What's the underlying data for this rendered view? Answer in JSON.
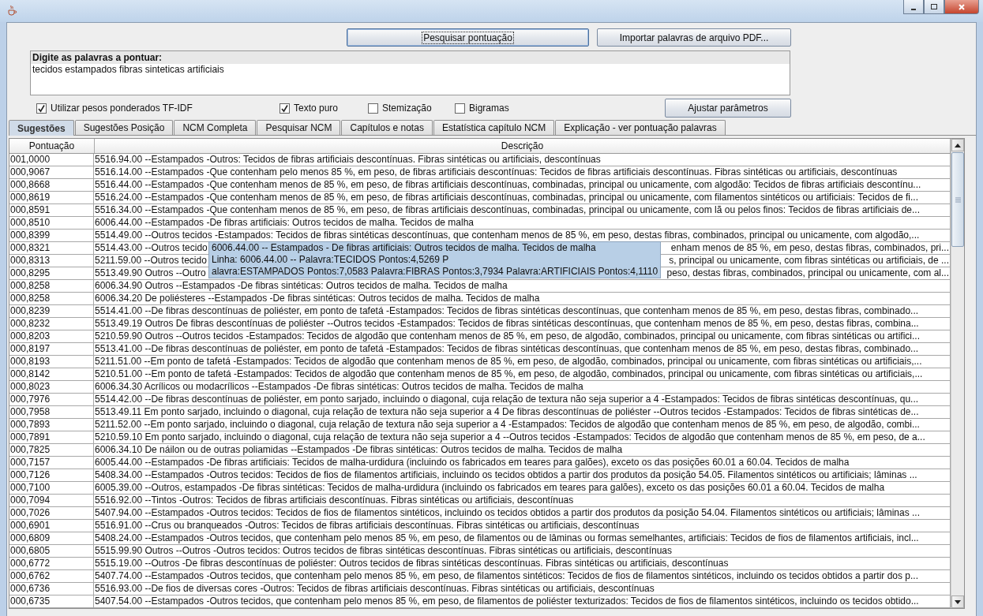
{
  "actions": [
    {
      "label": "Pesquisar pontuação",
      "focused": true
    },
    {
      "label": "Importar palavras de arquivo PDF...",
      "focused": false
    }
  ],
  "query": {
    "label": "Digite as palavras a pontuar:",
    "value": "tecidos estampados fibras sinteticas artificiais"
  },
  "options": [
    {
      "label": "Utilizar pesos ponderados TF-IDF",
      "checked": true
    },
    {
      "label": "Texto puro",
      "checked": true
    },
    {
      "label": "Stemização",
      "checked": false
    },
    {
      "label": "Bigramas",
      "checked": false
    }
  ],
  "adjust_button": "Ajustar parâmetros",
  "tabs": [
    {
      "label": "Sugestões",
      "selected": true
    },
    {
      "label": "Sugestões Posição",
      "selected": false
    },
    {
      "label": "NCM Completa",
      "selected": false
    },
    {
      "label": "Pesquisar NCM",
      "selected": false
    },
    {
      "label": "Capítulos e notas",
      "selected": false
    },
    {
      "label": "Estatística capítulo NCM",
      "selected": false
    },
    {
      "label": "Explicação - ver pontuação palavras",
      "selected": false
    }
  ],
  "table": {
    "columns": [
      "Pontuação",
      "Descrição"
    ],
    "rows": [
      {
        "score": "001,0000",
        "description": "5516.94.00 --Estampados -Outros: Tecidos de fibras artificiais descontínuas. Fibras sintéticas ou artificiais, descontínuas"
      },
      {
        "score": "000,9067",
        "description": "5516.14.00 --Estampados -Que contenham pelo menos 85 %, em peso, de fibras artificiais descontínuas: Tecidos de fibras artificiais descontínuas. Fibras sintéticas ou artificiais, descontínuas"
      },
      {
        "score": "000,8668",
        "description": "5516.44.00 --Estampados -Que contenham menos de 85 %, em peso, de fibras artificiais descontínuas, combinadas, principal ou unicamente, com algodão: Tecidos de fibras artificiais descontínu..."
      },
      {
        "score": "000,8619",
        "description": "5516.24.00 --Estampados -Que contenham menos de 85 %, em peso, de fibras artificiais descontínuas, combinadas, principal ou unicamente, com filamentos sintéticos ou artificiais: Tecidos de fi..."
      },
      {
        "score": "000,8591",
        "description": "5516.34.00 --Estampados -Que contenham menos de 85 %, em peso, de fibras artificiais descontínuas, combinadas, principal ou unicamente, com lã ou pelos finos: Tecidos de fibras artificiais de..."
      },
      {
        "score": "000,8510",
        "description": "6006.44.00 --Estampados -De fibras artificiais: Outros tecidos de malha. Tecidos de malha"
      },
      {
        "score": "000,8399",
        "description": "5514.49.00 --Outros tecidos -Estampados: Tecidos de fibras sintéticas descontínuas, que contenham menos de 85 %, em peso, destas fibras, combinados, principal ou unicamente, com algodão,..."
      },
      {
        "score": "000,8321",
        "description": "5514.43.00 --Outros tecido",
        "description_tail": "enham menos de 85 %, em peso, destas fibras, combinados, pri..."
      },
      {
        "score": "000,8313",
        "description": "5211.59.00 --Outros tecido",
        "description_tail": "s, principal ou unicamente, com fibras sintéticas ou artificiais, de ..."
      },
      {
        "score": "000,8295",
        "description": "5513.49.90 Outros --Outro",
        "description_tail": "peso, destas fibras, combinados, principal ou unicamente, com al..."
      },
      {
        "score": "000,8258",
        "description": "6006.34.90 Outros --Estampados -De fibras sintéticas: Outros tecidos de malha. Tecidos de malha"
      },
      {
        "score": "000,8258",
        "description": "6006.34.20 De poliésteres --Estampados -De fibras sintéticas: Outros tecidos de malha. Tecidos de malha"
      },
      {
        "score": "000,8239",
        "description": "5514.41.00 --De fibras descontínuas de poliéster, em ponto de tafetá -Estampados: Tecidos de fibras sintéticas descontínuas, que contenham menos de 85 %, em peso, destas fibras, combinado..."
      },
      {
        "score": "000,8232",
        "description": "5513.49.19 Outros De fibras descontínuas de poliéster --Outros tecidos -Estampados: Tecidos de fibras sintéticas descontínuas, que contenham menos de 85 %, em peso, destas fibras, combina..."
      },
      {
        "score": "000,8203",
        "description": "5210.59.90 Outros --Outros tecidos -Estampados: Tecidos de algodão que contenham menos de 85 %, em peso, de algodão, combinados, principal ou unicamente, com fibras sintéticas ou artifici..."
      },
      {
        "score": "000,8197",
        "description": "5513.41.00 --De fibras descontínuas de poliéster, em ponto de tafetá -Estampados: Tecidos de fibras sintéticas descontínuas, que contenham menos de 85 %, em peso, destas fibras, combinado..."
      },
      {
        "score": "000,8193",
        "description": "5211.51.00 --Em ponto de tafetá -Estampados: Tecidos de algodão que contenham menos de 85 %, em peso, de algodão, combinados, principal ou unicamente, com fibras sintéticas ou artificiais,..."
      },
      {
        "score": "000,8142",
        "description": "5210.51.00 --Em ponto de tafetá -Estampados: Tecidos de algodão que contenham menos de 85 %, em peso, de algodão, combinados, principal ou unicamente, com fibras sintéticas ou artificiais,..."
      },
      {
        "score": "000,8023",
        "description": "6006.34.30 Acrílicos ou modacrílicos --Estampados -De fibras sintéticas: Outros tecidos de malha. Tecidos de malha"
      },
      {
        "score": "000,7976",
        "description": "5514.42.00 --De fibras descontínuas de poliéster, em ponto sarjado, incluindo o diagonal, cuja relação de textura não seja superior a 4 -Estampados: Tecidos de fibras sintéticas descontínuas, qu..."
      },
      {
        "score": "000,7958",
        "description": "5513.49.11 Em ponto sarjado, incluindo o diagonal, cuja relação de textura não seja superior a 4 De fibras descontínuas de poliéster --Outros tecidos -Estampados: Tecidos de fibras sintéticas de..."
      },
      {
        "score": "000,7893",
        "description": "5211.52.00 --Em ponto sarjado, incluindo o diagonal, cuja relação de textura não seja superior a 4 -Estampados: Tecidos de algodão que contenham menos de 85 %, em peso, de algodão, combi..."
      },
      {
        "score": "000,7891",
        "description": "5210.59.10 Em ponto sarjado, incluindo o diagonal, cuja relação de textura não seja superior a 4 --Outros tecidos -Estampados: Tecidos de algodão que contenham menos de 85 %, em peso, de a..."
      },
      {
        "score": "000,7825",
        "description": "6006.34.10 De náilon ou de outras poliamidas --Estampados -De fibras sintéticas: Outros tecidos de malha. Tecidos de malha"
      },
      {
        "score": "000,7157",
        "description": "6005.44.00 --Estampados -De fibras artificiais: Tecidos de malha-urdidura (incluindo os fabricados em teares para galões), exceto os das posições 60.01 a 60.04. Tecidos de malha"
      },
      {
        "score": "000,7126",
        "description": "5408.34.00 --Estampados -Outros tecidos: Tecidos de fios de filamentos artificiais, incluindo os tecidos obtidos a partir dos produtos da posição 54.05. Filamentos sintéticos ou artificiais; lâminas ..."
      },
      {
        "score": "000,7100",
        "description": "6005.39.00 --Outros, estampados -De fibras sintéticas: Tecidos de malha-urdidura (incluindo os fabricados em teares para galões), exceto os das posições 60.01 a 60.04. Tecidos de malha"
      },
      {
        "score": "000,7094",
        "description": "5516.92.00 --Tintos -Outros: Tecidos de fibras artificiais descontínuas. Fibras sintéticas ou artificiais, descontínuas"
      },
      {
        "score": "000,7026",
        "description": "5407.94.00 --Estampados -Outros tecidos: Tecidos de fios de filamentos sintéticos, incluindo os tecidos obtidos a partir dos produtos da posição 54.04. Filamentos sintéticos ou artificiais; lâminas ..."
      },
      {
        "score": "000,6901",
        "description": "5516.91.00 --Crus ou branqueados -Outros: Tecidos de fibras artificiais descontínuas. Fibras sintéticas ou artificiais, descontínuas"
      },
      {
        "score": "000,6809",
        "description": "5408.24.00 --Estampados -Outros tecidos, que contenham pelo menos 85 %, em peso, de filamentos ou de lâminas ou formas semelhantes, artificiais: Tecidos de fios de filamentos artificiais, incl..."
      },
      {
        "score": "000,6805",
        "description": "5515.99.90 Outros --Outros -Outros tecidos: Outros tecidos de fibras sintéticas descontínuas. Fibras sintéticas ou artificiais, descontínuas"
      },
      {
        "score": "000,6772",
        "description": "5515.19.00 --Outros -De fibras descontínuas de poliéster: Outros tecidos de fibras sintéticas descontínuas. Fibras sintéticas ou artificiais, descontínuas"
      },
      {
        "score": "000,6762",
        "description": "5407.74.00 --Estampados -Outros tecidos, que contenham pelo menos 85 %, em peso, de filamentos sintéticos: Tecidos de fios de filamentos sintéticos, incluindo os tecidos obtidos a partir dos p..."
      },
      {
        "score": "000,6736",
        "description": "5516.93.00 --De fios de diversas cores -Outros: Tecidos de fibras artificiais descontínuas. Fibras sintéticas ou artificiais, descontínuas"
      },
      {
        "score": "000,6735",
        "description": "5407.54.00 --Estampados -Outros tecidos, que contenham pelo menos 85 %, em peso, de filamentos de poliéster texturizados: Tecidos de fios de filamentos sintéticos, incluindo os tecidos obtido..."
      }
    ]
  },
  "tooltip": {
    "lines": [
      "6006.44.00 -- Estampados - De fibras artificiais: Outros tecidos de malha. Tecidos de malha",
      "Linha: 6006.44.00 -- Palavra:TECIDOS Pontos:4,5269 P",
      "alavra:ESTAMPADOS Pontos:7,0583 Palavra:FIBRAS Pontos:3,7934 Palavra:ARTIFICIAIS Pontos:4,1110"
    ]
  }
}
